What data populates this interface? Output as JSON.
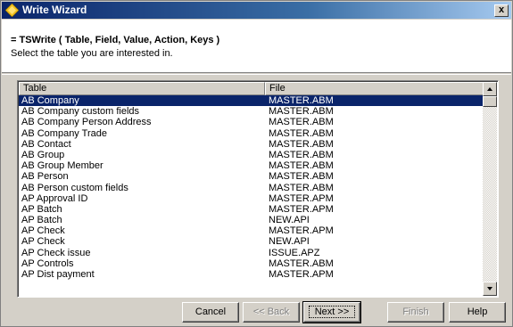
{
  "window": {
    "title": "Write Wizard",
    "close_glyph": "x",
    "icon": "diamond-icon"
  },
  "header": {
    "title": "= TSWrite ( Table, Field, Value, Action, Keys )",
    "description": "Select the table you are interested in."
  },
  "grid": {
    "columns": [
      "Table",
      "File"
    ],
    "selected_index": 0,
    "rows": [
      [
        "AB Company",
        "MASTER.ABM"
      ],
      [
        "AB Company custom fields",
        "MASTER.ABM"
      ],
      [
        "AB Company Person Address",
        "MASTER.ABM"
      ],
      [
        "AB Company Trade",
        "MASTER.ABM"
      ],
      [
        "AB Contact",
        "MASTER.ABM"
      ],
      [
        "AB Group",
        "MASTER.ABM"
      ],
      [
        "AB Group Member",
        "MASTER.ABM"
      ],
      [
        "AB Person",
        "MASTER.ABM"
      ],
      [
        "AB Person custom fields",
        "MASTER.ABM"
      ],
      [
        "AP Approval ID",
        "MASTER.APM"
      ],
      [
        "AP Batch",
        "MASTER.APM"
      ],
      [
        "AP Batch",
        "NEW.API"
      ],
      [
        "AP Check",
        "MASTER.APM"
      ],
      [
        "AP Check",
        "NEW.API"
      ],
      [
        "AP Check issue",
        "ISSUE.APZ"
      ],
      [
        "AP Controls",
        "MASTER.ABM"
      ],
      [
        "AP Dist payment",
        "MASTER.APM"
      ]
    ]
  },
  "buttons": {
    "cancel": "Cancel",
    "back": "<< Back",
    "next": "Next >>",
    "finish": "Finish",
    "help": "Help"
  },
  "colors": {
    "titlebar": "#0a246a",
    "selection": "#0a246a",
    "face": "#d4d0c8"
  }
}
